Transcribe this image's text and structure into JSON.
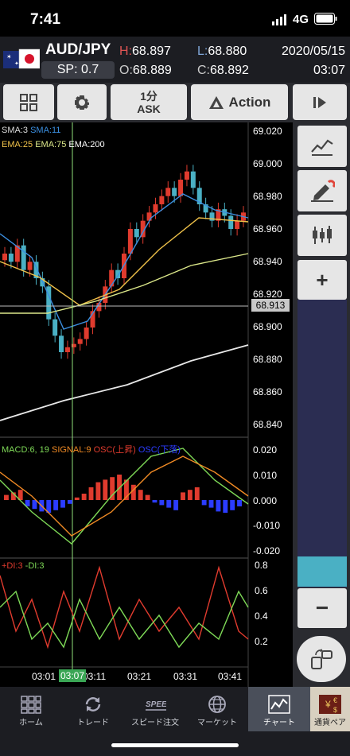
{
  "status": {
    "time": "7:41",
    "network": "4G"
  },
  "quote": {
    "symbol": "AUD/JPY",
    "spread": "SP: 0.7",
    "high_label": "H:",
    "high": "68.897",
    "open_label": "O:",
    "open": "68.889",
    "low_label": "L:",
    "low": "68.880",
    "close_label": "C:",
    "close": "68.892",
    "date": "2020/05/15",
    "time": "03:07"
  },
  "toolbar": {
    "grid_icon": "grid-icon",
    "settings_icon": "gear-icon",
    "timeframe": "1分",
    "price_type": "ASK",
    "action_label": "Action",
    "play_icon": "play-icon"
  },
  "chart": {
    "indicator_legend": [
      {
        "label": "SMA:3",
        "color": "#dcdcdc"
      },
      {
        "label": "SMA:11",
        "color": "#3b8fe0"
      },
      {
        "label": "EMA:25",
        "color": "#f0c24a"
      },
      {
        "label": "EMA:75",
        "color": "#dce88a"
      },
      {
        "label": "EMA:200",
        "color": "#ffffff"
      }
    ],
    "price_ticks": [
      "69.020",
      "69.000",
      "68.980",
      "68.960",
      "68.940",
      "68.920",
      "68.900",
      "68.880",
      "68.860",
      "68.840"
    ],
    "current_price": "68.913",
    "macd_legend": [
      {
        "label": "MACD:6, 19",
        "color": "#7ed957"
      },
      {
        "label": "SIGNAL:9",
        "color": "#f08a24"
      },
      {
        "label": "OSC(上昇)",
        "color": "#e03b2e"
      },
      {
        "label": "OSC(下落)",
        "color": "#2b3cff"
      }
    ],
    "macd_ticks": [
      "0.020",
      "0.010",
      "0.000",
      "-0.010",
      "-0.020"
    ],
    "dmi_legend": [
      {
        "label": "+DI:3",
        "color": "#e03b2e"
      },
      {
        "label": "-DI:3",
        "color": "#7ed957"
      }
    ],
    "dmi_ticks": [
      "0.8",
      "0.6",
      "0.4",
      "0.2"
    ],
    "time_ticks": [
      "03:01",
      "03:07",
      "03:11",
      "03:21",
      "03:31",
      "03:41"
    ],
    "cursor_time": "03:07"
  },
  "chart_data": {
    "type": "candlestick",
    "title": "",
    "ylim": [
      68.83,
      69.03
    ],
    "grid": false
  },
  "sidepanel": {
    "tools": [
      "line-chart-icon",
      "draw-pen-icon",
      "candlestick-icon"
    ],
    "zoom_in": "+",
    "zoom_out": "−",
    "rotate_icon": "rotate-screen-icon"
  },
  "nav": {
    "items": [
      {
        "label": "ホーム",
        "icon": "home-grid-icon"
      },
      {
        "label": "トレード",
        "icon": "trade-arrows-icon"
      },
      {
        "label": "スピード注文",
        "icon": "speed-icon"
      },
      {
        "label": "マーケット",
        "icon": "globe-icon"
      },
      {
        "label": "チャート",
        "icon": "chart-icon"
      },
      {
        "label": "通貨ペア",
        "icon": "currency-pair-icon"
      }
    ]
  }
}
